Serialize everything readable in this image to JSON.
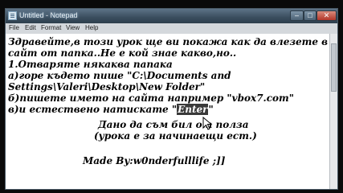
{
  "window": {
    "title": "Untitled - Notepad",
    "minimize_glyph": "–",
    "maximize_glyph": "□",
    "close_glyph": "✕"
  },
  "menu": [
    "File",
    "Edit",
    "Format",
    "View",
    "Help"
  ],
  "editor_lines": [
    "Здравейте,в този урок ще ви покажа как да влезете в",
    "сайт от папка..Не е кой знае какво,но..",
    "1.Отваряте някаква папака",
    "а)горе където пише \"C:\\Documents and",
    "Settings\\Valeri\\Desktop\\New Folder\"",
    "б)пишете името на сайта например \"vbox7.com\"",
    "в)и естествено натискате \"",
    "\"",
    "Дано да съм бил от полза",
    "(урока е за начинаещи ест.)",
    "Made By:w0nderfulllife ;]]"
  ],
  "selected_word": "Enter",
  "colors": {
    "selection_bg": "#3a3a3a",
    "close_button": "#c0392b",
    "titlebar": "#3a4d5e"
  }
}
